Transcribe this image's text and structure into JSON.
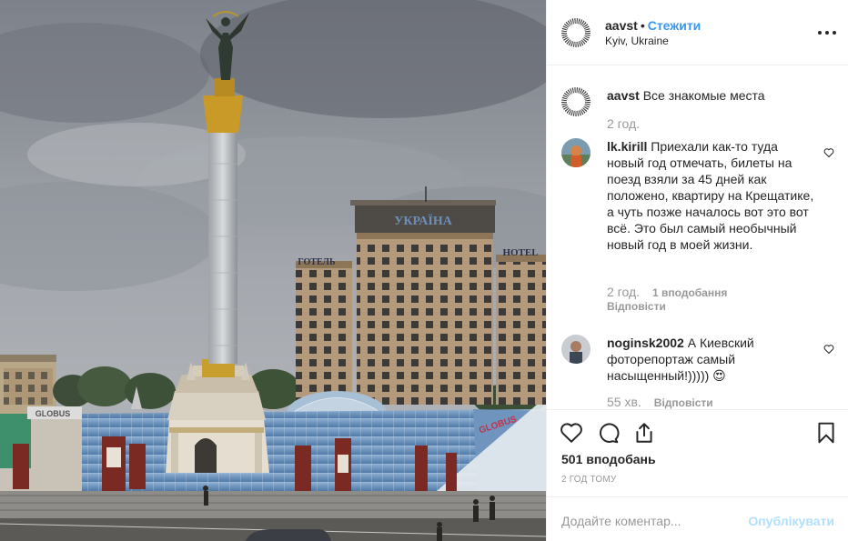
{
  "photo": {
    "description_icon": "photo-image",
    "signs": {
      "hotel_ua": "ГОТЕЛЬ",
      "hotel_en": "HOTEL",
      "ukraina": "УКРАЇНА",
      "globus_left": "GLOBUS",
      "globus_right": "GLOBUS"
    }
  },
  "header": {
    "username": "aavst",
    "separator": "•",
    "follow_label": "Стежити",
    "location": "Kyiv, Ukraine",
    "more_icon": "more-horizontal-icon"
  },
  "caption": {
    "username": "aavst",
    "text": "Все знакомые места",
    "time": "2 год."
  },
  "comments": [
    {
      "username": "lk.kirill",
      "text": "Приехали как-то туда новый год отмечать, билеты на поезд взяли за 45 дней как положено, квартиру на Крещатике, а чуть позже началось вот это вот всё. Это был самый необычный новый год в моей жизни.",
      "time": "2 год.",
      "likes": "1 вподобання",
      "reply": "Відповісти"
    },
    {
      "username": "noginsk2002",
      "text": "А Киевский фоторепортаж самый насыщенный!))))) 😍",
      "time": "55 хв.",
      "reply": "Відповісти"
    }
  ],
  "actions": {
    "like_icon": "heart-icon",
    "comment_icon": "comment-icon",
    "share_icon": "share-icon",
    "save_icon": "bookmark-icon",
    "likes_count": "501 вподобань",
    "post_time": "2 ГОД ТОМУ"
  },
  "add_comment": {
    "placeholder": "Додайте коментар...",
    "publish_label": "Опублікувати"
  },
  "colors": {
    "accent": "#3897f0",
    "publish_disabled": "#b2dffc",
    "muted": "#999999",
    "text": "#262626"
  }
}
